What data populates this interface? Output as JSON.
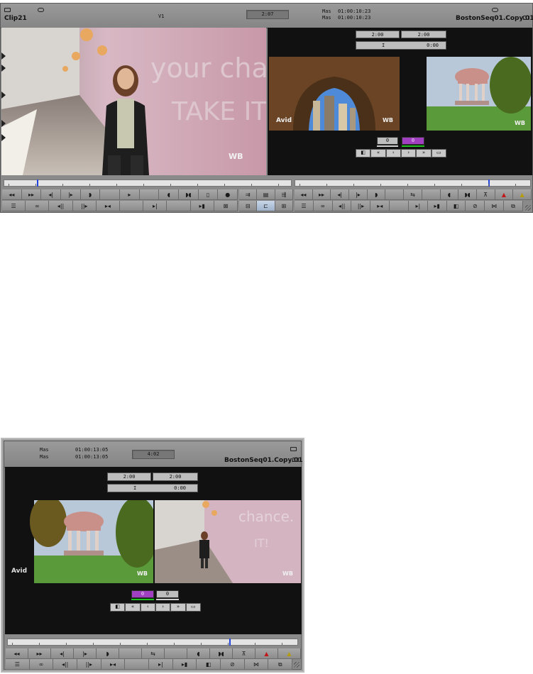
{
  "top_window": {
    "source": {
      "title": "Clip21",
      "track": "V1",
      "duration": "2:07"
    },
    "record": {
      "row1_label": "Mas",
      "row1_tc": "01:00:10:23",
      "row2_label": "Mas",
      "row2_tc": "01:00:10:23",
      "title": "BostonSeq01.Copy.01"
    },
    "trim": {
      "left_value": "2:00",
      "right_value": "2:00",
      "offset": "0:00",
      "in_icon": "I",
      "counter_a": "0",
      "counter_b": "0"
    },
    "trim_buttons": [
      "◧",
      "«",
      "‹",
      "›",
      "»",
      "▭"
    ],
    "source_buttons_row1": [
      "◂◂",
      "▸▸",
      "◂|",
      "|▸",
      "◗",
      "",
      "▸",
      "",
      "◖",
      "◗◖",
      "▯",
      "●"
    ],
    "source_buttons_row2": [
      "☰",
      "∞",
      "◂||",
      "||▸",
      "▸◂",
      "",
      "▸|",
      "",
      "▸▮",
      "⊠"
    ],
    "mid_buttons_row1": [
      "⇉",
      "▤",
      "⇶"
    ],
    "mid_buttons_row2": [
      "⊟",
      "⊏",
      "⊞"
    ],
    "record_buttons_row1": [
      "◂◂",
      "▸▸",
      "◂|",
      "|▸",
      "◗",
      "",
      "⇆",
      "",
      "◖",
      "◗◖",
      "⊼",
      "▲",
      "▲"
    ],
    "record_buttons_row2": [
      "☰",
      "∞",
      "◂||",
      "||▸",
      "▸◂",
      "",
      "▸|",
      "▸▮",
      "◧",
      "⊘",
      "⋈",
      "⧉"
    ],
    "source_timeline": {
      "playhead": 0.12
    },
    "record_timeline": {
      "playhead": 0.82
    }
  },
  "bottom_window": {
    "row1_label": "Mas",
    "row1_tc": "01:00:13:05",
    "row2_label": "Mas",
    "row2_tc": "01:00:13:05",
    "duration": "4:02",
    "title": "BostonSeq01.Copy.01",
    "trim": {
      "left_value": "2:00",
      "right_value": "2:00",
      "offset": "0:00",
      "in_icon": "I",
      "counter_a": "0",
      "counter_b": "0"
    },
    "trim_buttons": [
      "◧",
      "«",
      "‹",
      "›",
      "»",
      "▭"
    ],
    "buttons_row1": [
      "◂◂",
      "▸▸",
      "◂|",
      "|▸",
      "◗",
      "",
      "⇆",
      "",
      "◖",
      "◗◖",
      "⊼",
      "▲",
      "▲"
    ],
    "buttons_row2": [
      "☰",
      "∞",
      "◂||",
      "||▸",
      "▸◂",
      "",
      "▸|",
      "▸▮",
      "◧",
      "⊘",
      "⋈",
      "⧉"
    ],
    "timeline": {
      "playhead": 0.76
    }
  },
  "colors": {
    "panel": "#8a8a8a",
    "dark": "#111111",
    "purple_counter": "#a040c0",
    "green_underline": "#20c020",
    "playhead": "#2244dd",
    "red_marker": "#c01818",
    "yellow_marker": "#b59b10"
  }
}
